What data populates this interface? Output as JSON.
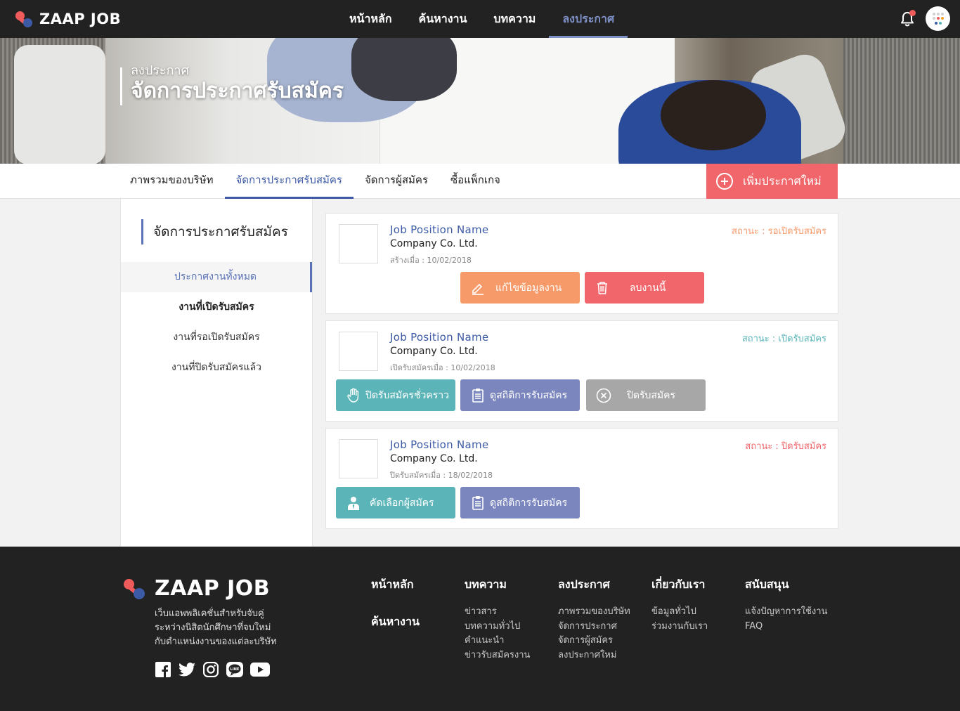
{
  "brand": {
    "name": "ZAAP JOB",
    "colors": {
      "primary": "#3c5aa6",
      "accent": "#ef5b5b"
    }
  },
  "topnav": {
    "items": [
      {
        "label": "หน้าหลัก",
        "active": false
      },
      {
        "label": "ค้นหางาน",
        "active": false
      },
      {
        "label": "บทความ",
        "active": false
      },
      {
        "label": "ลงประกาศ",
        "active": true
      }
    ],
    "icons": [
      "bell-icon",
      "avatar"
    ]
  },
  "hero": {
    "subtitle": "ลงประกาศ",
    "title": "จัดการประกาศรับสมัคร"
  },
  "subnav": {
    "items": [
      {
        "label": "ภาพรวมของบริษัท",
        "active": false
      },
      {
        "label": "จัดการประกาศรับสมัคร",
        "active": true
      },
      {
        "label": "จัดการผู้สมัคร",
        "active": false
      },
      {
        "label": "ซื้อแพ็กเกจ",
        "active": false
      }
    ],
    "add_button": "เพิ่มประกาศใหม่"
  },
  "sidebar": {
    "heading": "จัดการประกาศรับสมัคร",
    "items": [
      {
        "label": "ประกาศงานทั้งหมด",
        "active": true
      },
      {
        "label": "งานที่เปิดรับสมัคร",
        "active": false
      },
      {
        "label": "งานที่รอเปิดรับสมัคร",
        "active": false
      },
      {
        "label": "งานที่ปิดรับสมัครแล้ว",
        "active": false
      }
    ]
  },
  "jobs": [
    {
      "title": "Job Position Name",
      "company": "Company Co. Ltd.",
      "date": "สร้างเมื่อ : 10/02/2018",
      "status": "สถานะ : รอเปิดรับสมัคร",
      "status_color": "#f79a6a",
      "buttons": [
        "แก้ไขข้อมูลงาน",
        "ลบงานนี้"
      ]
    },
    {
      "title": "Job Position Name",
      "company": "Company Co. Ltd.",
      "date": "เปิดรับสมัครเมื่อ : 10/02/2018",
      "status": "สถานะ : เปิดรับสมัคร",
      "status_color": "#5bb5b8",
      "buttons": [
        "ปิดรับสมัครชั่วคราว",
        "ดูสถิติการรับสมัคร",
        "ปิดรับสมัคร"
      ]
    },
    {
      "title": "Job Position Name",
      "company": "Company Co. Ltd.",
      "date": "ปิดรับสมัครเมื่อ : 18/02/2018",
      "status": "สถานะ : ปิดรับสมัคร",
      "status_color": "#f0666a",
      "buttons": [
        "คัดเลือกผู้สมัคร",
        "ดูสถิติการรับสมัคร"
      ]
    }
  ],
  "footer": {
    "brand": "ZAAP JOB",
    "description": [
      "เว็บแอพพลิเคชั่นสำหรับจับคู่",
      "ระหว่างนิสิตนักศึกษาที่จบใหม่",
      "กับตำแหน่งงานของแต่ละบริษัท"
    ],
    "social": [
      "facebook-icon",
      "twitter-icon",
      "instagram-icon",
      "line-icon",
      "youtube-icon"
    ],
    "col1": {
      "head1": "หน้าหลัก",
      "head2": "ค้นหางาน"
    },
    "col2": {
      "head": "บทความ",
      "links": [
        "ข่าวสาร",
        "บทความทั่วไป",
        "คำแนะนำ",
        "ข่าวรับสมัครงาน"
      ]
    },
    "col3": {
      "head": "ลงประกาศ",
      "links": [
        "ภาพรวมของบริษัท",
        "จัดการประกาศ",
        "จัดการผู้สมัคร",
        "ลงประกาศใหม่"
      ]
    },
    "col4": {
      "head": "เกี่ยวกับเรา",
      "links": [
        "ข้อมูลทั่วไป",
        "ร่วมงานกับเรา"
      ]
    },
    "col5": {
      "head": "สนับสนุน",
      "links": [
        "แจ้งปัญหาการใช้งาน",
        "FAQ"
      ]
    }
  }
}
